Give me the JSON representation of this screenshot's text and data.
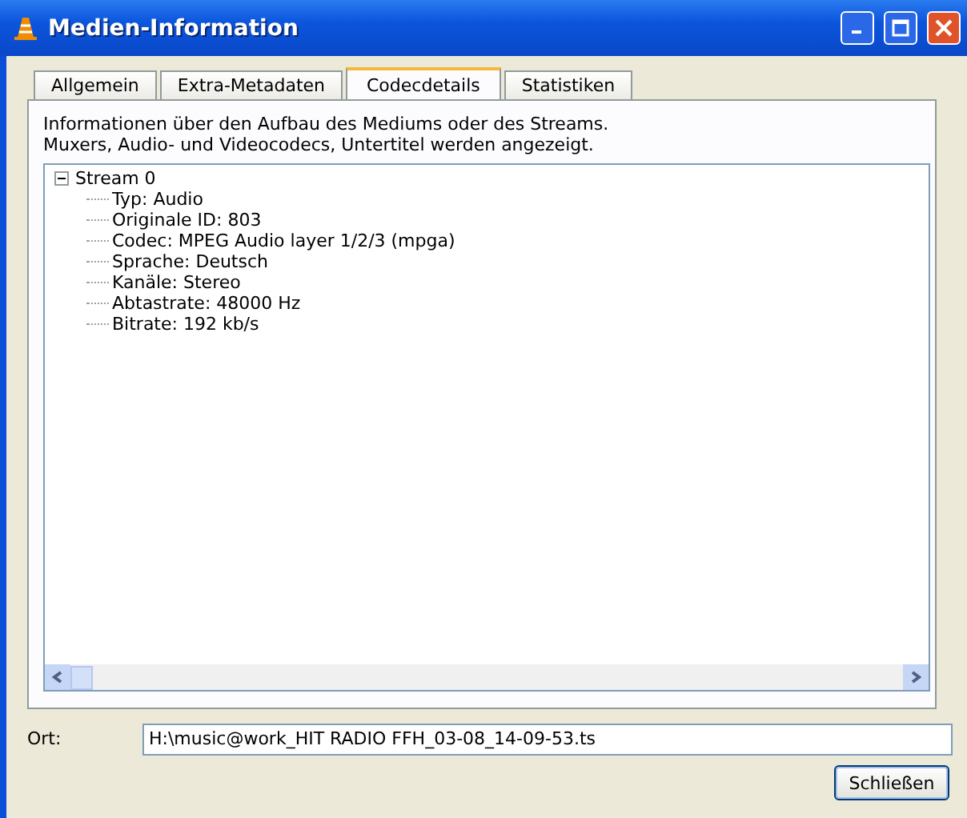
{
  "window": {
    "title": "Medien-Information"
  },
  "tabs": [
    {
      "label": "Allgemein",
      "selected": false
    },
    {
      "label": "Extra-Metadaten",
      "selected": false
    },
    {
      "label": "Codecdetails",
      "selected": true
    },
    {
      "label": "Statistiken",
      "selected": false
    }
  ],
  "description": [
    "Informationen über den Aufbau des Mediums oder des Streams.",
    "Muxers, Audio- und Videocodecs, Untertitel werden angezeigt."
  ],
  "tree": [
    {
      "label": "Stream 0",
      "expanded": true,
      "children": [
        {
          "label": "Typ: Audio"
        },
        {
          "label": "Originale ID: 803"
        },
        {
          "label": "Codec: MPEG Audio layer 1/2/3 (mpga)"
        },
        {
          "label": "Sprache: Deutsch"
        },
        {
          "label": "Kanäle: Stereo"
        },
        {
          "label": "Abtastrate: 48000 Hz"
        },
        {
          "label": "Bitrate: 192 kb/s"
        }
      ]
    }
  ],
  "location": {
    "label": "Ort:",
    "value": "H:\\music@work_HIT RADIO FFH_03-08_14-09-53.ts"
  },
  "buttons": [
    "Schließen"
  ]
}
